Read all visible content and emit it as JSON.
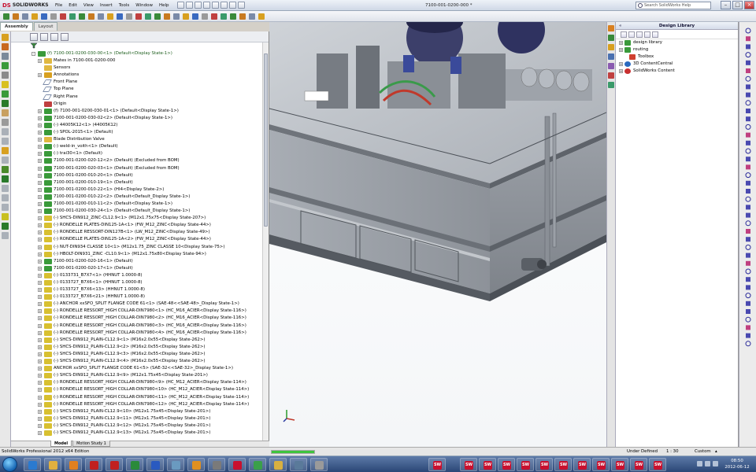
{
  "titlebar": {
    "logo_text": "SOLIDWORKS",
    "logo_prefix": "DS",
    "menu": [
      "File",
      "Edit",
      "View",
      "Insert",
      "Tools",
      "Window",
      "Help"
    ],
    "document_title": "7100-001-0200-000 *",
    "search_placeholder": "Search SolidWorks Help"
  },
  "tabs": [
    "Assembly",
    "Layout"
  ],
  "tree": {
    "rows": [
      {
        "text": "(f) 7100-001-0200-030-00<1> (Default<Display State-1>)",
        "icon": "assembly",
        "exp": "-",
        "indent": 0
      },
      {
        "text": "Mates in 7100-001-0200-000",
        "icon": "folder",
        "exp": "+",
        "indent": 1
      },
      {
        "text": "Sensors",
        "icon": "folder",
        "exp": "",
        "indent": 1
      },
      {
        "text": "Annotations",
        "icon": "annotation",
        "exp": "+",
        "indent": 1
      },
      {
        "text": "Front Plane",
        "icon": "plane",
        "exp": "",
        "indent": 1
      },
      {
        "text": "Top Plane",
        "icon": "plane",
        "exp": "",
        "indent": 1
      },
      {
        "text": "Right Plane",
        "icon": "plane",
        "exp": "",
        "indent": 1
      },
      {
        "text": "Origin",
        "icon": "origin",
        "exp": "",
        "indent": 1
      },
      {
        "text": "(f) 7100-001-0200-030-01<1> (Default<Display State-1>)",
        "icon": "assembly",
        "exp": "+",
        "indent": 1
      },
      {
        "text": "7100-001-0200-030-02<2> (Default<Display State-1>)",
        "icon": "assembly",
        "exp": "+",
        "indent": 1
      },
      {
        "text": "(-) 44005K12<1> (44005K12)",
        "icon": "assembly",
        "exp": "+",
        "indent": 1
      },
      {
        "text": "(-) SPOL-2015<1> (Default)",
        "icon": "assembly",
        "exp": "+",
        "indent": 1
      },
      {
        "text": "Blade Distribution Valve",
        "icon": "folder",
        "exp": "+",
        "indent": 1
      },
      {
        "text": "(-) weld-in_voith<1> (Default)",
        "icon": "assembly",
        "exp": "+",
        "indent": 1
      },
      {
        "text": "(-) trai30<1> (Default)",
        "icon": "assembly",
        "exp": "+",
        "indent": 1
      },
      {
        "text": "7100-001-0200-020-12<2> (Default) (Excluded from BOM)",
        "icon": "assembly",
        "exp": "+",
        "indent": 1
      },
      {
        "text": "7100-001-0200-020-03<1> (Default) (Excluded from BOM)",
        "icon": "assembly",
        "exp": "+",
        "indent": 1
      },
      {
        "text": "7100-001-0200-010-20<1> (Default)",
        "icon": "assembly",
        "exp": "+",
        "indent": 1
      },
      {
        "text": "7100-001-0200-010-19<1> (Default)",
        "icon": "assembly",
        "exp": "+",
        "indent": 1
      },
      {
        "text": "7100-001-0200-010-22<1> (HI4<Display State-2>)",
        "icon": "assembly",
        "exp": "+",
        "indent": 1
      },
      {
        "text": "7100-001-0200-010-22<2> (Default<Default_Display State-1>)",
        "icon": "assembly",
        "exp": "+",
        "indent": 1
      },
      {
        "text": "7100-001-0200-010-11<2> (Default<Display State-1>)",
        "icon": "assembly",
        "exp": "+",
        "indent": 1
      },
      {
        "text": "7100-001-0200-030-24<1> (Default<Default_Display State-1>)",
        "icon": "assembly",
        "exp": "+",
        "indent": 1
      },
      {
        "text": "(-) SHCS-DIN912_ZINC-CL12.9<1> (M12x1.75x75<Display State-207>)",
        "icon": "part",
        "exp": "+",
        "indent": 1
      },
      {
        "text": "(-) RONDELLE PLATES-DIN125-1A<1> (FW_M12_ZINC<Display State-44>)",
        "icon": "part",
        "exp": "+",
        "indent": 1
      },
      {
        "text": "(-) RONDELLE RESSORT-DIN127B<1> (LW_M12_ZINC<Display State-49>)",
        "icon": "part",
        "exp": "+",
        "indent": 1
      },
      {
        "text": "(-) RONDELLE PLATES-DIN125-1A<2> (FW_M12_ZINC<Display State-44>)",
        "icon": "part",
        "exp": "+",
        "indent": 1
      },
      {
        "text": "(-) NUT-DIN934 CLASSE 10<1> (M12x1.75_ZINC CLASSE 10<Display State-75>)",
        "icon": "part",
        "exp": "+",
        "indent": 1
      },
      {
        "text": "(-) HBOLT-DIN931_ZINC -CL10.9<1> (M12x1.75x80<Display State-94>)",
        "icon": "part",
        "exp": "+",
        "indent": 1
      },
      {
        "text": "7100-001-0200-020-16<1> (Default)",
        "icon": "assembly",
        "exp": "+",
        "indent": 1
      },
      {
        "text": "7100-001-0200-020-17<1> (Default)",
        "icon": "assembly",
        "exp": "+",
        "indent": 1
      },
      {
        "text": "(-) 0133731_B7X7<1> (HHNUT 1.0000-8)",
        "icon": "part",
        "exp": "+",
        "indent": 1
      },
      {
        "text": "(-) 0133727_B7X6<1> (HHNUT 1.0000-8)",
        "icon": "part",
        "exp": "+",
        "indent": 1
      },
      {
        "text": "(-) 0133727_B7X6<13> (HHNUT 1.0000-8)",
        "icon": "part",
        "exp": "+",
        "indent": 1
      },
      {
        "text": "(-) 0133727_B7X6<21> (HHNUT 1.0000-8)",
        "icon": "part",
        "exp": "+",
        "indent": 1
      },
      {
        "text": "(-) ANCHOR xxSFO_SPLIT FLANGE CODE 61<1> (SAE-48<<SAE-48>_Display State-1>)",
        "icon": "part",
        "exp": "+",
        "indent": 1
      },
      {
        "text": "(-) RONDELLE RESSORT_HIGH COLLAR-DIN7980<1> (HC_M16_ACIER<Display State-116>)",
        "icon": "part",
        "exp": "+",
        "indent": 1
      },
      {
        "text": "(-) RONDELLE RESSORT_HIGH COLLAR-DIN7980<2> (HC_M16_ACIER<Display State-116>)",
        "icon": "part",
        "exp": "+",
        "indent": 1
      },
      {
        "text": "(-) RONDELLE RESSORT_HIGH COLLAR-DIN7980<3> (HC_M16_ACIER<Display State-116>)",
        "icon": "part",
        "exp": "+",
        "indent": 1
      },
      {
        "text": "(-) RONDELLE RESSORT_HIGH COLLAR-DIN7980<4> (HC_M16_ACIER<Display State-116>)",
        "icon": "part",
        "exp": "+",
        "indent": 1
      },
      {
        "text": "(-) SHCS-DIN912_PLAIN-CL12.9<1> (M16x2.0x55<Display State-262>)",
        "icon": "part",
        "exp": "+",
        "indent": 1
      },
      {
        "text": "(-) SHCS-DIN912_PLAIN-CL12.9<2> (M16x2.0x55<Display State-262>)",
        "icon": "part",
        "exp": "+",
        "indent": 1
      },
      {
        "text": "(-) SHCS-DIN912_PLAIN-CL12.9<3> (M16x2.0x55<Display State-262>)",
        "icon": "part",
        "exp": "+",
        "indent": 1
      },
      {
        "text": "(-) SHCS-DIN912_PLAIN-CL12.9<4> (M16x2.0x55<Display State-262>)",
        "icon": "part",
        "exp": "+",
        "indent": 1
      },
      {
        "text": "ANCHOR xxSFO_SPLIT FLANGE CODE 61<5> (SAE-32<<SAE-32>_Display State-1>)",
        "icon": "part",
        "exp": "+",
        "indent": 1
      },
      {
        "text": "(-) SHCS-DIN912_PLAIN-CL12.9<9> (M12x1.75x45<Display State-201>)",
        "icon": "part",
        "exp": "+",
        "indent": 1
      },
      {
        "text": "(-) RONDELLE RESSORT_HIGH COLLAR-DIN7980<9> (HC_M12_ACIER<Display State-114>)",
        "icon": "part",
        "exp": "+",
        "indent": 1
      },
      {
        "text": "(-) RONDELLE RESSORT_HIGH COLLAR-DIN7980<10> (HC_M12_ACIER<Display State-114>)",
        "icon": "part",
        "exp": "+",
        "indent": 1
      },
      {
        "text": "(-) RONDELLE RESSORT_HIGH COLLAR-DIN7980<11> (HC_M12_ACIER<Display State-114>)",
        "icon": "part",
        "exp": "+",
        "indent": 1
      },
      {
        "text": "(-) RONDELLE RESSORT_HIGH COLLAR-DIN7980<12> (HC_M12_ACIER<Display State-114>)",
        "icon": "part",
        "exp": "+",
        "indent": 1
      },
      {
        "text": "(-) SHCS-DIN912_PLAIN-CL12.9<10> (M12x1.75x45<Display State-201>)",
        "icon": "part",
        "exp": "+",
        "indent": 1
      },
      {
        "text": "(-) SHCS-DIN912_PLAIN-CL12.9<11> (M12x1.75x45<Display State-201>)",
        "icon": "part",
        "exp": "+",
        "indent": 1
      },
      {
        "text": "(-) SHCS-DIN912_PLAIN-CL12.9<12> (M12x1.75x45<Display State-201>)",
        "icon": "part",
        "exp": "+",
        "indent": 1
      },
      {
        "text": "(-) SHCS-DIN912_PLAIN-CL12.9<13> (M12x1.75x45<Display State-201>)",
        "icon": "part",
        "exp": "+",
        "indent": 1
      }
    ]
  },
  "model_tabs": [
    "Model",
    "Motion Study 1"
  ],
  "design_library": {
    "title": "Design Library",
    "items": [
      {
        "text": "design library",
        "icon": "folder",
        "exp": "+"
      },
      {
        "text": "routing",
        "icon": "folder",
        "exp": "+"
      },
      {
        "text": "Toolbox",
        "icon": "toolbox",
        "exp": ""
      },
      {
        "text": "3D ContentCentral",
        "icon": "globe",
        "exp": "+"
      },
      {
        "text": "SolidWorks Content",
        "icon": "globe-red",
        "exp": "+"
      }
    ]
  },
  "statusbar": {
    "left": "SolidWorks Professional 2012 x64 Edition",
    "state": "Under Defined",
    "scale": "1 : 30",
    "units": "Custom",
    "progress": 1.0
  },
  "taskbar": {
    "time": "08:50",
    "date": "2012-06-12",
    "sw_label": "SW"
  },
  "colors": {
    "accent": "#1a5c1a",
    "sw_red": "#c8102e",
    "steel": "#8f949c"
  }
}
